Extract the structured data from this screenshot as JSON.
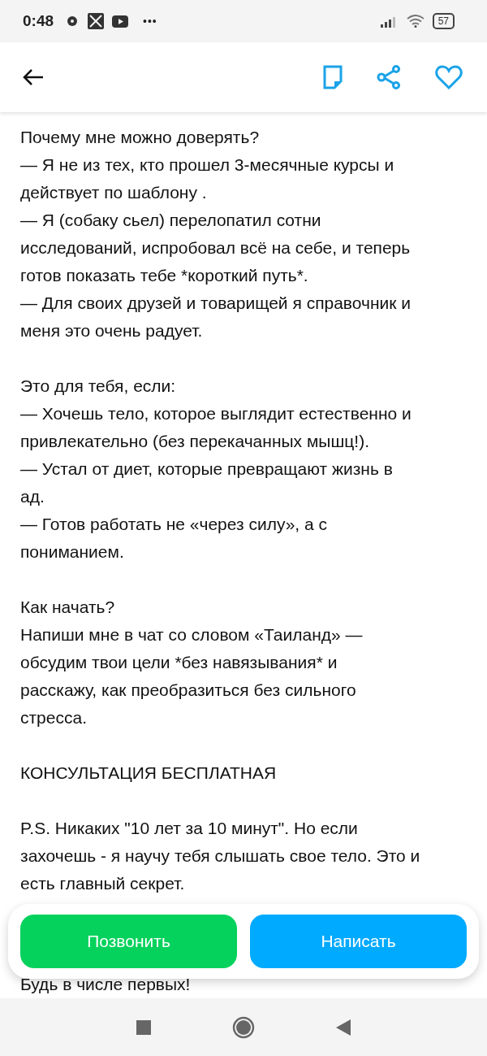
{
  "status_bar": {
    "time": "0:48",
    "more": "•••",
    "battery": "57"
  },
  "blocks": [
    {
      "lines": [
        "Почему мне можно доверять?",
        "— Я не из тех, кто прошел 3-месячные курсы  и",
        "действует по шаблону .",
        "— Я (собаку сьел) перелопатил сотни",
        "исследований, испробовал всё на себе, и теперь",
        "готов показать тебе *короткий путь*.",
        "— Для своих друзей и товарищей я справочник и",
        "меня это очень радует."
      ]
    },
    {
      "lines": [
        "Это для тебя, если:",
        "— Хочешь тело, которое выглядит естественно и",
        "привлекательно (без перекачанных мышц!).",
        "— Устал от диет, которые превращают жизнь в",
        "ад.",
        "— Готов работать не «через силу», а с",
        "пониманием."
      ]
    },
    {
      "lines": [
        "Как начать?",
        "Напиши мне в чат со словом «Таиланд» —",
        "обсудим твои цели *без навязывания* и",
        "расскажу, как преобразиться без сильного",
        "стресса."
      ]
    },
    {
      "lines": [
        "КОНСУЛЬТАЦИЯ БЕСПЛАТНАЯ"
      ]
    },
    {
      "lines": [
        "P.S. Никаких \"10 лет за 10 минут\". Но если",
        "захочешь - я научу тебя слышать свое тело. Это и",
        "есть главный секрет."
      ]
    }
  ],
  "partial_line": "Будь в числе первых!",
  "actions": [
    {
      "label": "Позвонить",
      "kind": "call"
    },
    {
      "label": "Написать",
      "kind": "message"
    }
  ]
}
